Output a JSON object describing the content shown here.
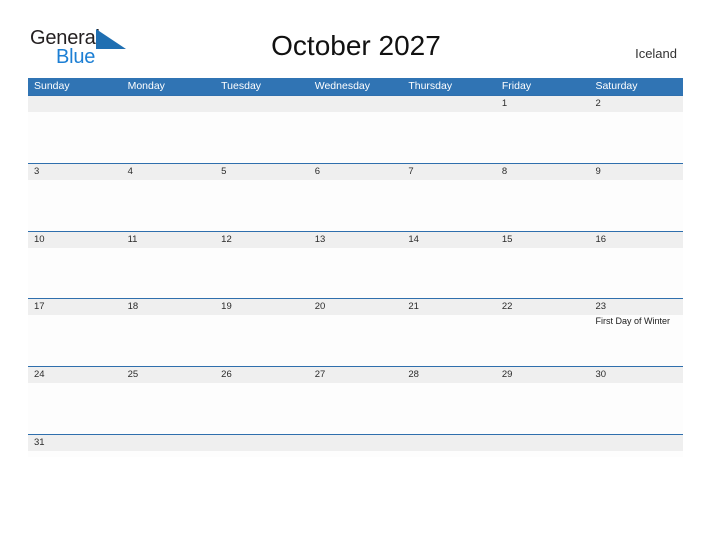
{
  "brand": {
    "name_part1": "General",
    "name_part2": "Blue",
    "flag_icon": "blue-flag-triangle",
    "color_dark": "#231f20",
    "color_blue": "#1c7fd4"
  },
  "header": {
    "title": "October 2027",
    "country": "Iceland"
  },
  "theme": {
    "header_blue": "#3074b4",
    "row_line_blue": "#2f6fad",
    "day_band_gray": "#efefef",
    "page_background": "#ffffff"
  },
  "calendar": {
    "month": "October",
    "year": "2027",
    "weekday_headers": [
      "Sunday",
      "Monday",
      "Tuesday",
      "Wednesday",
      "Thursday",
      "Friday",
      "Saturday"
    ],
    "weeks": [
      [
        {
          "num": "",
          "event": ""
        },
        {
          "num": "",
          "event": ""
        },
        {
          "num": "",
          "event": ""
        },
        {
          "num": "",
          "event": ""
        },
        {
          "num": "",
          "event": ""
        },
        {
          "num": "1",
          "event": ""
        },
        {
          "num": "2",
          "event": ""
        }
      ],
      [
        {
          "num": "3",
          "event": ""
        },
        {
          "num": "4",
          "event": ""
        },
        {
          "num": "5",
          "event": ""
        },
        {
          "num": "6",
          "event": ""
        },
        {
          "num": "7",
          "event": ""
        },
        {
          "num": "8",
          "event": ""
        },
        {
          "num": "9",
          "event": ""
        }
      ],
      [
        {
          "num": "10",
          "event": ""
        },
        {
          "num": "11",
          "event": ""
        },
        {
          "num": "12",
          "event": ""
        },
        {
          "num": "13",
          "event": ""
        },
        {
          "num": "14",
          "event": ""
        },
        {
          "num": "15",
          "event": ""
        },
        {
          "num": "16",
          "event": ""
        }
      ],
      [
        {
          "num": "17",
          "event": ""
        },
        {
          "num": "18",
          "event": ""
        },
        {
          "num": "19",
          "event": ""
        },
        {
          "num": "20",
          "event": ""
        },
        {
          "num": "21",
          "event": ""
        },
        {
          "num": "22",
          "event": ""
        },
        {
          "num": "23",
          "event": "First Day of Winter"
        }
      ],
      [
        {
          "num": "24",
          "event": ""
        },
        {
          "num": "25",
          "event": ""
        },
        {
          "num": "26",
          "event": ""
        },
        {
          "num": "27",
          "event": ""
        },
        {
          "num": "28",
          "event": ""
        },
        {
          "num": "29",
          "event": ""
        },
        {
          "num": "30",
          "event": ""
        }
      ],
      [
        {
          "num": "31",
          "event": ""
        },
        {
          "num": "",
          "event": ""
        },
        {
          "num": "",
          "event": ""
        },
        {
          "num": "",
          "event": ""
        },
        {
          "num": "",
          "event": ""
        },
        {
          "num": "",
          "event": ""
        },
        {
          "num": "",
          "event": ""
        }
      ]
    ]
  }
}
